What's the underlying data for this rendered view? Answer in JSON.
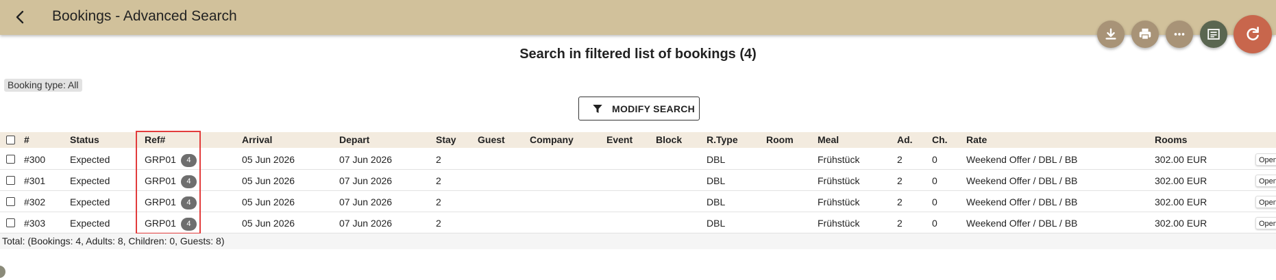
{
  "header": {
    "title": "Bookings - Advanced Search",
    "actions": [
      {
        "name": "download-button",
        "icon": "download-icon"
      },
      {
        "name": "print-button",
        "icon": "print-icon"
      },
      {
        "name": "more-button",
        "icon": "more-horizontal-icon"
      },
      {
        "name": "notes-button",
        "icon": "notes-icon"
      },
      {
        "name": "refresh-button",
        "icon": "refresh-icon"
      }
    ],
    "colors": {
      "bar": "#d1c19b",
      "fab": "#a89377",
      "fab_dark": "#5a6650",
      "fab_accent": "#c8664c"
    }
  },
  "heading": "Search in filtered list of bookings (4)",
  "filter_chip": "Booking type: All",
  "modify_button": "MODIFY SEARCH",
  "table": {
    "columns": {
      "num": "#",
      "status": "Status",
      "ref": "Ref#",
      "arrival": "Arrival",
      "depart": "Depart",
      "stay": "Stay",
      "guest": "Guest",
      "company": "Company",
      "event": "Event",
      "block": "Block",
      "rtype": "R.Type",
      "room": "Room",
      "meal": "Meal",
      "ad": "Ad.",
      "ch": "Ch.",
      "rate": "Rate",
      "rooms": "Rooms"
    },
    "rows": [
      {
        "num": "#300",
        "status": "Expected",
        "ref": "GRP01",
        "ref_count": "4",
        "arrival": "05 Jun 2026",
        "depart": "07 Jun 2026",
        "stay": "2",
        "guest": "",
        "company": "",
        "event": "",
        "block": "",
        "rtype": "DBL",
        "room": "",
        "meal": "Frühstück",
        "ad": "2",
        "ch": "0",
        "rate": "Weekend Offer / DBL / BB",
        "rooms": "302.00 EUR",
        "action": "Open"
      },
      {
        "num": "#301",
        "status": "Expected",
        "ref": "GRP01",
        "ref_count": "4",
        "arrival": "05 Jun 2026",
        "depart": "07 Jun 2026",
        "stay": "2",
        "guest": "",
        "company": "",
        "event": "",
        "block": "",
        "rtype": "DBL",
        "room": "",
        "meal": "Frühstück",
        "ad": "2",
        "ch": "0",
        "rate": "Weekend Offer / DBL / BB",
        "rooms": "302.00 EUR",
        "action": "Open"
      },
      {
        "num": "#302",
        "status": "Expected",
        "ref": "GRP01",
        "ref_count": "4",
        "arrival": "05 Jun 2026",
        "depart": "07 Jun 2026",
        "stay": "2",
        "guest": "",
        "company": "",
        "event": "",
        "block": "",
        "rtype": "DBL",
        "room": "",
        "meal": "Frühstück",
        "ad": "2",
        "ch": "0",
        "rate": "Weekend Offer / DBL / BB",
        "rooms": "302.00 EUR",
        "action": "Open"
      },
      {
        "num": "#303",
        "status": "Expected",
        "ref": "GRP01",
        "ref_count": "4",
        "arrival": "05 Jun 2026",
        "depart": "07 Jun 2026",
        "stay": "2",
        "guest": "",
        "company": "",
        "event": "",
        "block": "",
        "rtype": "DBL",
        "room": "",
        "meal": "Frühstück",
        "ad": "2",
        "ch": "0",
        "rate": "Weekend Offer / DBL / BB",
        "rooms": "302.00 EUR",
        "action": "Open"
      }
    ],
    "total": "Total: (Bookings: 4, Adults: 8, Children: 0, Guests: 8)"
  }
}
